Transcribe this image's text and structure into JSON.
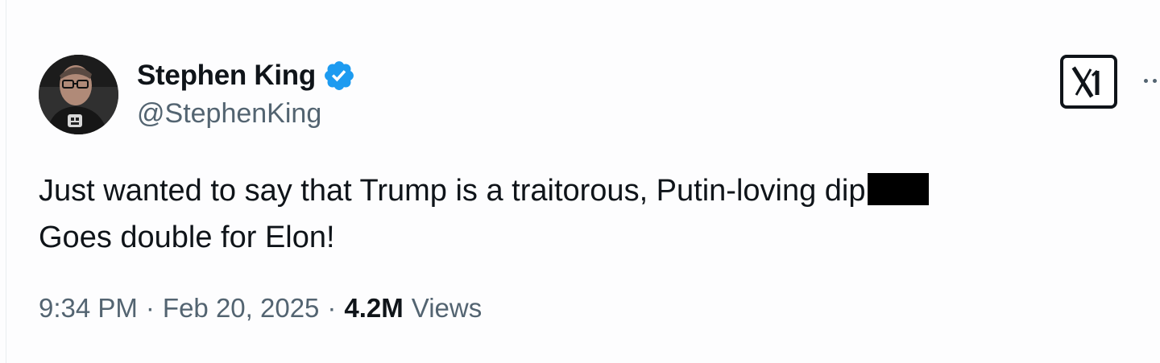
{
  "author": {
    "display_name": "Stephen King",
    "handle": "@StephenKing",
    "verified": true,
    "avatar_icon": "user-avatar-photo"
  },
  "tweet": {
    "line1": "Just wanted to say that Trump is a traitorous, Putin-loving dip",
    "line2": "Goes double for Elon!",
    "redacted": true
  },
  "meta": {
    "time": "9:34 PM",
    "separator": "·",
    "date": "Feb 20, 2025",
    "views_count": "4.2M",
    "views_label": "Views"
  },
  "icons": {
    "verified": "verified-badge-icon",
    "logo": "x-logo-icon",
    "more": "more-options-icon"
  },
  "colors": {
    "verified_blue": "#1d9bf0",
    "text_primary": "#0f1419",
    "text_secondary": "#536471"
  }
}
